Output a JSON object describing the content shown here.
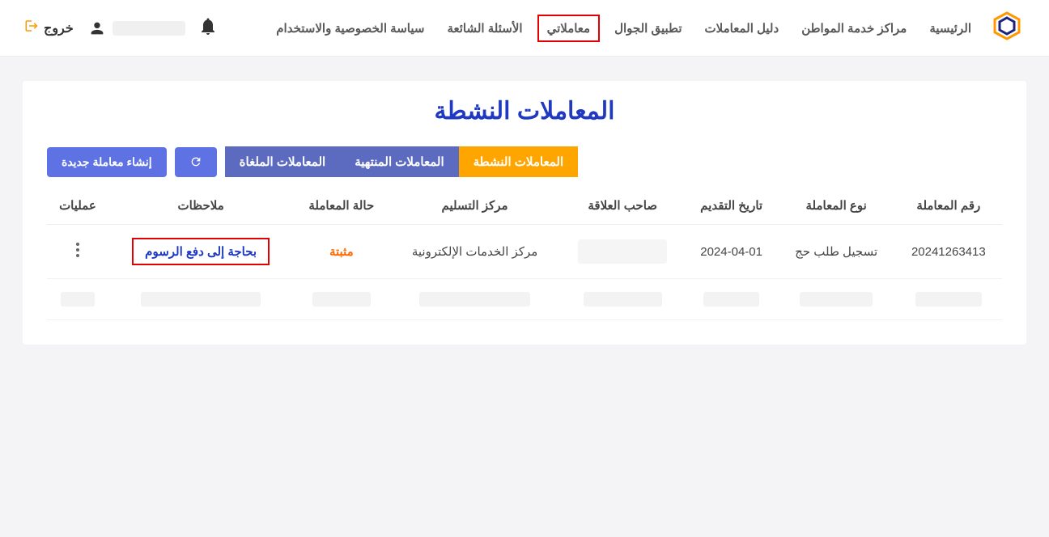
{
  "nav": {
    "home": "الرئيسية",
    "centers": "مراكز خدمة المواطن",
    "guide": "دليل المعاملات",
    "mobile": "تطبيق الجوال",
    "transactions": "معاملاتي",
    "faq": "الأسئلة الشائعة",
    "privacy": "سياسة الخصوصية والاستخدام",
    "logout": "خروج"
  },
  "page": {
    "title": "المعاملات النشطة"
  },
  "tabs": {
    "active": "المعاملات النشطة",
    "finished": "المعاملات المنتهية",
    "cancelled": "المعاملات الملغاة"
  },
  "buttons": {
    "create": "إنشاء معاملة جديدة"
  },
  "table": {
    "headers": {
      "number": "رقم المعاملة",
      "type": "نوع المعاملة",
      "date": "تاريخ التقديم",
      "owner": "صاحب العلاقة",
      "center": "مركز التسليم",
      "status": "حالة المعاملة",
      "notes": "ملاحظات",
      "actions": "عمليات"
    },
    "rows": [
      {
        "number": "20241263413",
        "type": "تسجيل طلب حج",
        "date": "2024-04-01",
        "owner": "",
        "center": "مركز الخدمات الإلكترونية",
        "status": "مثبتة",
        "notes": "بحاجة إلى دفع الرسوم"
      }
    ]
  }
}
